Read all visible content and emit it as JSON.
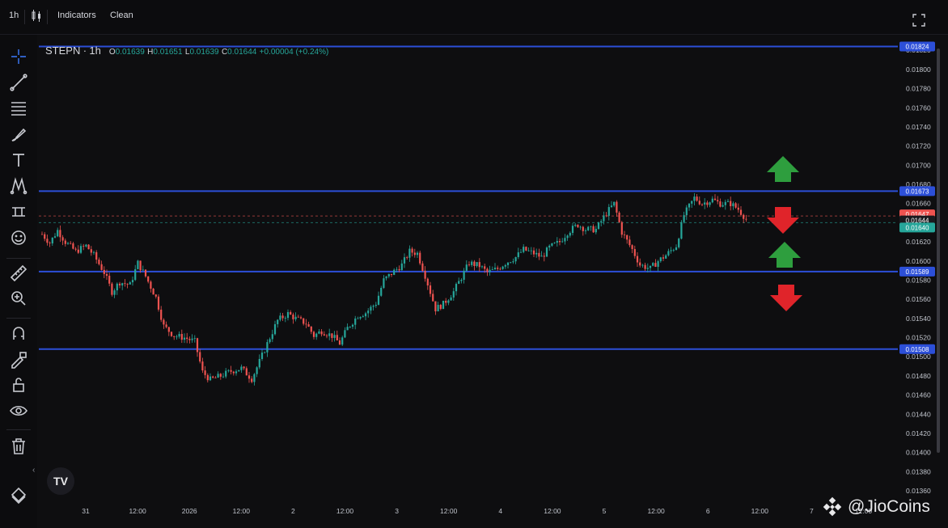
{
  "toolbar": {
    "interval": "1h",
    "indicators_label": "Indicators",
    "clean_label": "Clean"
  },
  "legend": {
    "symbol": "STEPN",
    "separator": "·",
    "timeframe": "1h",
    "o_label": "O",
    "o": "0.01639",
    "h_label": "H",
    "h": "0.01651",
    "l_label": "L",
    "l": "0.01639",
    "c_label": "C",
    "c": "0.01644",
    "change": "+0.00004 (+0.24%)"
  },
  "colors": {
    "background": "#0e0e10",
    "up": "#26a69a",
    "down": "#ef5350",
    "hline": "#2c4fd8",
    "arrow_up": "#2e9e3e",
    "arrow_down": "#e0242a"
  },
  "chart_data": {
    "type": "candlestick",
    "symbol": "STEPN",
    "interval": "1h",
    "y_ticks": [
      "0.01820",
      "0.01800",
      "0.01780",
      "0.01760",
      "0.01740",
      "0.01720",
      "0.01700",
      "0.01680",
      "0.01660",
      "0.01620",
      "0.01600",
      "0.01580",
      "0.01560",
      "0.01540",
      "0.01520",
      "0.01500",
      "0.01480",
      "0.01460",
      "0.01440",
      "0.01420",
      "0.01400",
      "0.01380",
      "0.01360"
    ],
    "ylim": [
      0.01355,
      0.01832
    ],
    "x_ticks": [
      "31",
      "12:00",
      "2026",
      "12:00",
      "2",
      "12:00",
      "3",
      "12:00",
      "4",
      "12:00",
      "5",
      "12:00",
      "6",
      "12:00",
      "7",
      "12:00"
    ],
    "horizontal_lines": [
      "0.01824",
      "0.01673",
      "0.01589",
      "0.01508"
    ],
    "price_tags": [
      {
        "label": "0.01824",
        "value": 0.01824,
        "color": "#2c4fd8"
      },
      {
        "label": "0.01673",
        "value": 0.01673,
        "color": "#2c4fd8"
      },
      {
        "label": "0.01647",
        "value": 0.01647,
        "color": "#ef5350"
      },
      {
        "label": "0.01644",
        "value": 0.01644,
        "color": "#1a1a1e"
      },
      {
        "label": "0.01640",
        "value": 0.0164,
        "color": "#26a69a"
      },
      {
        "label": "0.01589",
        "value": 0.01589,
        "color": "#2c4fd8"
      },
      {
        "label": "0.01508",
        "value": 0.01508,
        "color": "#2c4fd8"
      }
    ],
    "dashed_lines": [
      {
        "value": 0.01647,
        "color": "#ef5350"
      },
      {
        "value": 0.0164,
        "color": "#26a69a"
      }
    ],
    "close_path": [
      [
        0,
        0.01628
      ],
      [
        3,
        0.01619
      ],
      [
        6,
        0.01632
      ],
      [
        9,
        0.0162
      ],
      [
        13,
        0.0161
      ],
      [
        17,
        0.01616
      ],
      [
        20,
        0.01606
      ],
      [
        24,
        0.01588
      ],
      [
        27,
        0.01568
      ],
      [
        30,
        0.01578
      ],
      [
        34,
        0.01575
      ],
      [
        37,
        0.01598
      ],
      [
        40,
        0.01584
      ],
      [
        44,
        0.01562
      ],
      [
        47,
        0.01532
      ],
      [
        51,
        0.01522
      ],
      [
        55,
        0.0152
      ],
      [
        59,
        0.01516
      ],
      [
        62,
        0.01484
      ],
      [
        65,
        0.01476
      ],
      [
        69,
        0.0148
      ],
      [
        73,
        0.01485
      ],
      [
        77,
        0.01488
      ],
      [
        81,
        0.01477
      ],
      [
        84,
        0.01495
      ],
      [
        88,
        0.0152
      ],
      [
        91,
        0.01538
      ],
      [
        95,
        0.01545
      ],
      [
        98,
        0.0154
      ],
      [
        102,
        0.01535
      ],
      [
        105,
        0.01522
      ],
      [
        108,
        0.01527
      ],
      [
        112,
        0.01522
      ],
      [
        115,
        0.01514
      ],
      [
        118,
        0.0153
      ],
      [
        122,
        0.01543
      ],
      [
        125,
        0.01546
      ],
      [
        129,
        0.01556
      ],
      [
        132,
        0.0158
      ],
      [
        135,
        0.01587
      ],
      [
        139,
        0.01596
      ],
      [
        142,
        0.0161
      ],
      [
        145,
        0.01608
      ],
      [
        148,
        0.01585
      ],
      [
        152,
        0.0155
      ],
      [
        155,
        0.01555
      ],
      [
        159,
        0.01568
      ],
      [
        162,
        0.01583
      ],
      [
        165,
        0.01598
      ],
      [
        169,
        0.01595
      ],
      [
        172,
        0.01588
      ],
      [
        176,
        0.01592
      ],
      [
        179,
        0.01598
      ],
      [
        183,
        0.01604
      ],
      [
        186,
        0.01612
      ],
      [
        190,
        0.01608
      ],
      [
        193,
        0.01604
      ],
      [
        196,
        0.01614
      ],
      [
        200,
        0.0162
      ],
      [
        203,
        0.0163
      ],
      [
        207,
        0.01638
      ],
      [
        210,
        0.01633
      ],
      [
        214,
        0.01633
      ],
      [
        218,
        0.0165
      ],
      [
        221,
        0.0166
      ],
      [
        224,
        0.0163
      ],
      [
        228,
        0.01612
      ],
      [
        231,
        0.01596
      ],
      [
        235,
        0.01592
      ],
      [
        238,
        0.016
      ],
      [
        241,
        0.01606
      ],
      [
        245,
        0.01616
      ],
      [
        248,
        0.01648
      ],
      [
        252,
        0.01666
      ],
      [
        255,
        0.0166
      ],
      [
        259,
        0.01664
      ],
      [
        262,
        0.0166
      ],
      [
        266,
        0.0166
      ],
      [
        269,
        0.01654
      ],
      [
        272,
        0.01644
      ]
    ],
    "annotations": [
      {
        "type": "arrow-up",
        "color": "#2e9e3e"
      },
      {
        "type": "arrow-down",
        "color": "#e0242a"
      },
      {
        "type": "arrow-up",
        "color": "#2e9e3e"
      },
      {
        "type": "arrow-down",
        "color": "#e0242a"
      }
    ]
  },
  "sidebar": {
    "tools": [
      "crosshair-icon",
      "trend-line-icon",
      "fib-lines-icon",
      "brush-icon",
      "text-icon",
      "pattern-icon",
      "measure-range-icon",
      "emoji-icon",
      "ruler-icon",
      "zoom-in-icon",
      "magnet-icon",
      "lock-drawing-icon",
      "lock-icon",
      "eye-icon",
      "trash-icon",
      "layers-icon"
    ]
  },
  "watermark": {
    "text": "@JioCoins"
  },
  "logo": {
    "text": "TV"
  }
}
